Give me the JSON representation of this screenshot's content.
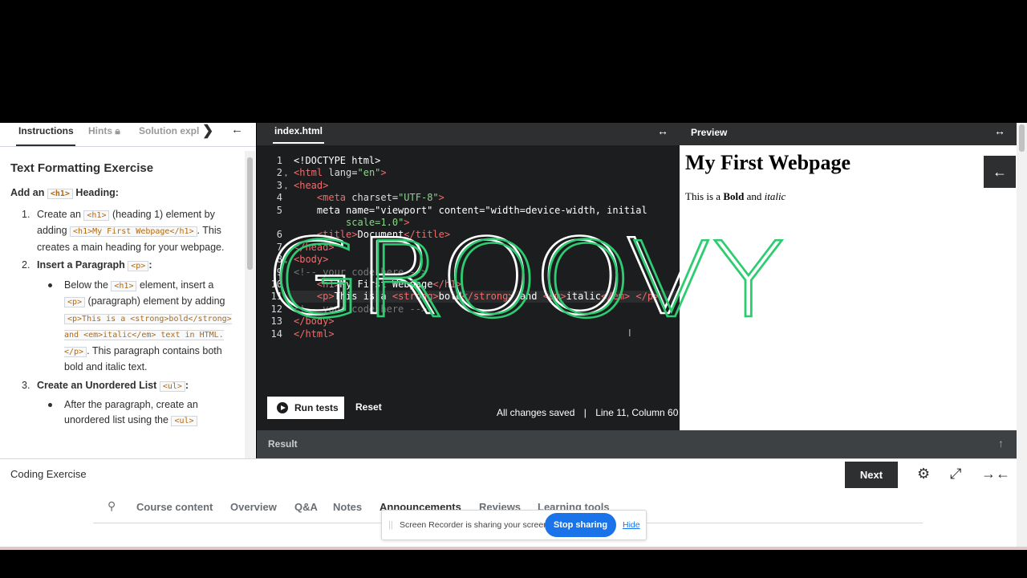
{
  "tabs": {
    "instructions": "Instructions",
    "hints": "Hints",
    "solution": "Solution expl",
    "next_icon": "chevron-right-icon",
    "collapse_icon": "arrow-left-icon"
  },
  "instructions": {
    "title": "Text Formatting Exercise",
    "section_prefix": "Add an",
    "section_code": "<h1>",
    "section_suffix": "Heading:",
    "step1_num": "1.",
    "step1_a": "Create an",
    "step1_code1": "<h1>",
    "step1_b": "(heading 1) element by adding",
    "step1_code2": "<h1>My First Webpage</h1>",
    "step1_c": ". This creates a main heading for your webpage.",
    "step2_num": "2.",
    "step2_title": "Insert a Paragraph",
    "step2_code": "<p>",
    "step2_colon": ":",
    "step2_bullet_a": "Below the",
    "step2_bullet_code1": "<h1>",
    "step2_bullet_b": "element, insert a",
    "step2_bullet_code2": "<p>",
    "step2_bullet_c": "(paragraph) element by adding",
    "step2_bullet_code3": "<p>This is a <strong>bold</strong> and <em>italic</em> text in HTML.</p>",
    "step2_bullet_d": ". This paragraph contains both bold and italic text.",
    "step3_num": "3.",
    "step3_title": "Create an Unordered List",
    "step3_code": "<ul>",
    "step3_colon": ":",
    "step3_bullet_a": "After the paragraph, create an unordered list using the",
    "step3_bullet_code": "<ul>"
  },
  "editor": {
    "filename": "index.html",
    "expand_icon": "expand-horizontal-icon",
    "run_label": "Run tests",
    "reset_label": "Reset",
    "saved_status": "All changes saved",
    "separator": "|",
    "cursor_position": "Line 11, Column 60"
  },
  "code_lines": [
    "<!DOCTYPE html>",
    "<html lang=\"en\">",
    "<head>",
    "    <meta charset=\"UTF-8\">",
    "    <meta name=\"viewport\" content=\"width=device-width, initial-scale=1.0\">",
    "    <title>Document</title>",
    "</head>",
    "<body>",
    "<!-- your code here -->",
    "    <h1>My First Webpage</h1>",
    "    <p>This is a <strong>bold</strong> and <em>italic</em> </p>",
    "<!-- your code here -->",
    "</body>",
    "</html>"
  ],
  "preview": {
    "title": "Preview",
    "heading": "My First Webpage",
    "para_prefix": "This is a ",
    "para_bold": "Bold",
    "para_mid": " and ",
    "para_italic": "italic",
    "back_icon": "arrow-left-icon"
  },
  "result": {
    "label": "Result",
    "arrow_icon": "arrow-up-icon"
  },
  "bottom": {
    "exercise_title": "Coding Exercise",
    "next_label": "Next",
    "settings_icon": "gear-icon",
    "fullscreen_icon": "expand-icon",
    "collapse_icon": "collapse-icon"
  },
  "course_nav": {
    "search_icon": "search-icon",
    "items": [
      "Course content",
      "Overview",
      "Q&A",
      "Notes",
      "Announcements",
      "Reviews",
      "Learning tools"
    ]
  },
  "share_bar": {
    "message": "Screen Recorder is sharing your screen.",
    "stop_label": "Stop sharing",
    "hide_label": "Hide"
  },
  "overlay_text": "GROOVY",
  "colors": {
    "overlay_white": "#ffffff",
    "overlay_green": "#2ecc71",
    "dark_panel": "#2d2f31",
    "stop_blue": "#1a73e8"
  }
}
